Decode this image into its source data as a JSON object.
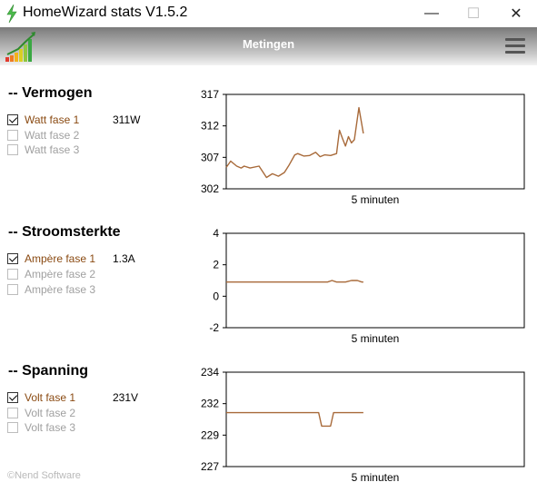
{
  "window": {
    "title": "HomeWizard stats V1.5.2",
    "minimize_glyph": "—",
    "maximize_glyph": "☐",
    "close_glyph": "✕"
  },
  "header": {
    "title": "Metingen",
    "menu_icon": "hamburger-menu-icon",
    "logo_icon": "bar-chart-logo-icon"
  },
  "colors": {
    "series": "#a86a3a",
    "active_label": "#8a4a12",
    "inactive_label": "#a0a0a0"
  },
  "sections": [
    {
      "title": "-- Vermogen",
      "checkboxes": [
        {
          "label": "Watt fase 1",
          "checked": true
        },
        {
          "label": "Watt fase 2",
          "checked": false
        },
        {
          "label": "Watt fase 3",
          "checked": false
        }
      ],
      "reading": "311W"
    },
    {
      "title": "-- Stroomsterkte",
      "checkboxes": [
        {
          "label": "Ampère fase 1",
          "checked": true
        },
        {
          "label": "Ampère fase 2",
          "checked": false
        },
        {
          "label": "Ampère fase 3",
          "checked": false
        }
      ],
      "reading": "1.3A"
    },
    {
      "title": "-- Spanning",
      "checkboxes": [
        {
          "label": "Volt fase 1",
          "checked": true
        },
        {
          "label": "Volt fase 2",
          "checked": false
        },
        {
          "label": "Volt fase 3",
          "checked": false
        }
      ],
      "reading": "231V"
    }
  ],
  "chart_data": [
    {
      "type": "line",
      "xlabel": "5 minuten",
      "ylim": [
        302,
        317
      ],
      "yticks": [
        "317",
        "312",
        "307",
        "302"
      ],
      "xlim": [
        0,
        100
      ],
      "series": [
        {
          "x": [
            0,
            1.5,
            3.5,
            5,
            6,
            8,
            11,
            13.5,
            15.5,
            17.5,
            19.5,
            21,
            23,
            24,
            26,
            28,
            30,
            31.5,
            33,
            35,
            37,
            38,
            39,
            40,
            41,
            42,
            43,
            44.5,
            46
          ],
          "values": [
            305.4,
            306.4,
            305.6,
            305.3,
            305.6,
            305.3,
            305.6,
            303.8,
            304.4,
            304.0,
            304.6,
            305.7,
            307.4,
            307.6,
            307.2,
            307.3,
            307.8,
            307.1,
            307.4,
            307.3,
            307.6,
            311.3,
            310.0,
            308.8,
            310.3,
            309.3,
            309.8,
            314.9,
            310.8
          ]
        }
      ]
    },
    {
      "type": "line",
      "xlabel": "5 minuten",
      "ylim": [
        -2,
        4
      ],
      "yticks": [
        "4",
        "2",
        "0",
        "-2"
      ],
      "xlim": [
        0,
        100
      ],
      "series": [
        {
          "x": [
            0,
            34,
            35.5,
            37,
            40,
            42,
            44,
            45.5,
            46
          ],
          "values": [
            0.9,
            0.9,
            1.0,
            0.9,
            0.9,
            1.0,
            1.0,
            0.9,
            0.9
          ]
        }
      ]
    },
    {
      "type": "line",
      "xlabel": "5 minuten",
      "ylim": [
        227,
        234
      ],
      "yticks": [
        "234",
        "232",
        "229",
        "227"
      ],
      "xlim": [
        0,
        100
      ],
      "series": [
        {
          "x": [
            0,
            9.5,
            10.5,
            16.5,
            17.5,
            20.5,
            21.5,
            26,
            26.5,
            31,
            32,
            35,
            36,
            40,
            41,
            46
          ],
          "values": [
            231.0,
            231.0,
            231.0,
            231.0,
            231.0,
            231.0,
            231.0,
            231.0,
            231.0,
            231.0,
            230.0,
            230.0,
            231.0,
            231.0,
            231.0,
            231.0
          ]
        }
      ]
    }
  ]
}
